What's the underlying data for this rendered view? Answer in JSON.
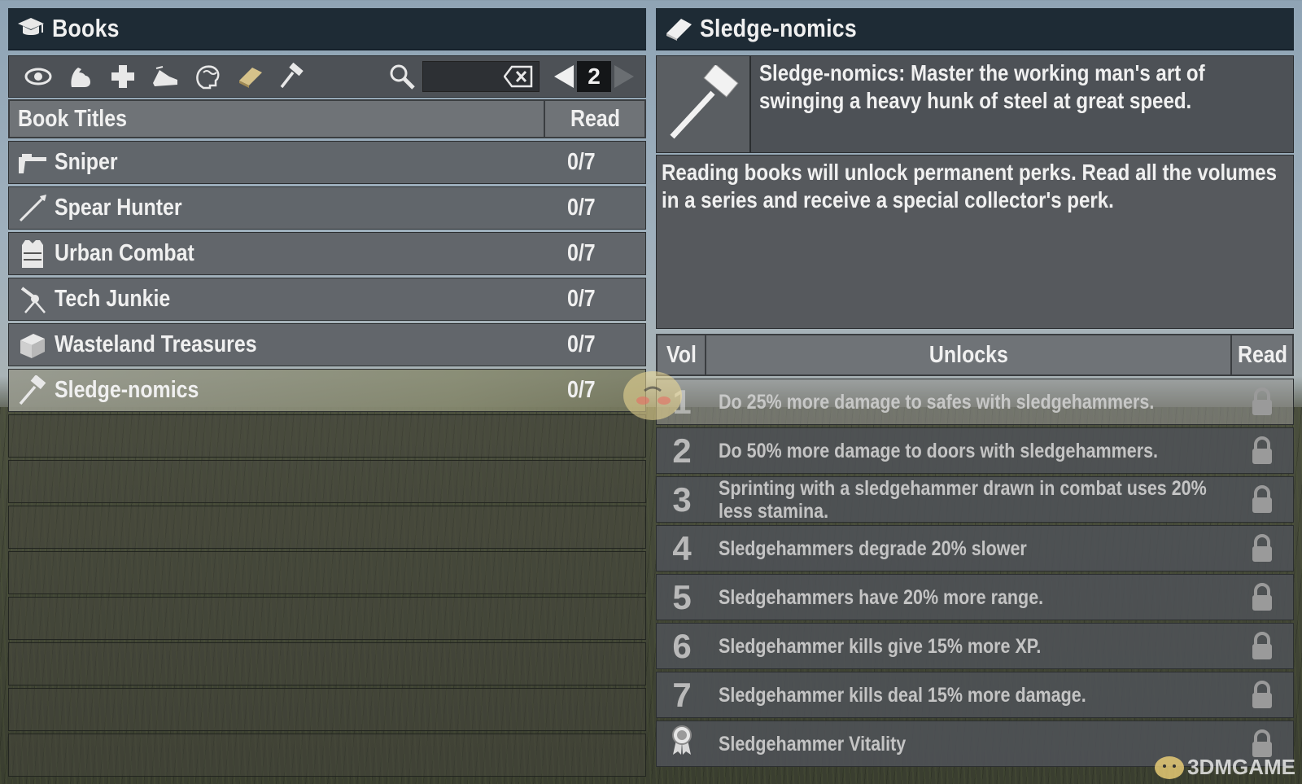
{
  "left": {
    "title": "Books",
    "title_icon": "graduation-cap-icon",
    "filters": [
      "eye-icon",
      "strength-arm-icon",
      "medical-cross-icon",
      "running-shoe-icon",
      "brain-icon",
      "book-icon",
      "hammer-icon"
    ],
    "search": {
      "value": "",
      "placeholder": ""
    },
    "page": "2",
    "columns": {
      "title": "Book Titles",
      "read": "Read"
    },
    "books": [
      {
        "name": "Sniper",
        "count": "0/7",
        "icon": "rifle-icon"
      },
      {
        "name": "Spear Hunter",
        "count": "0/7",
        "icon": "spear-icon"
      },
      {
        "name": "Urban Combat",
        "count": "0/7",
        "icon": "armor-vest-icon"
      },
      {
        "name": "Tech Junkie",
        "count": "0/7",
        "icon": "turret-icon"
      },
      {
        "name": "Wasteland Treasures",
        "count": "0/7",
        "icon": "treasure-chest-icon"
      },
      {
        "name": "Sledge-nomics",
        "count": "0/7",
        "icon": "sledgehammer-icon",
        "selected": true
      }
    ],
    "empty_rows": 8
  },
  "right": {
    "title": "Sledge-nomics",
    "title_icon": "book-icon",
    "summary": "Sledge-nomics: Master the working man's art of swinging a heavy hunk of steel at great speed.",
    "description": "Reading books will unlock permanent perks. Read all the volumes in a series and receive a special collector's perk.",
    "columns": {
      "vol": "Vol",
      "unlocks": "Unlocks",
      "read": "Read"
    },
    "perks": [
      {
        "vol": "1",
        "text": "Do 25% more damage to safes with sledgehammers."
      },
      {
        "vol": "2",
        "text": "Do 50% more damage to doors with sledgehammers."
      },
      {
        "vol": "3",
        "text": "Sprinting with a sledgehammer drawn in combat uses 20% less stamina."
      },
      {
        "vol": "4",
        "text": "Sledgehammers degrade 20% slower"
      },
      {
        "vol": "5",
        "text": "Sledgehammers have 20% more range."
      },
      {
        "vol": "6",
        "text": "Sledgehammer kills give 15% more XP."
      },
      {
        "vol": "7",
        "text": "Sledgehammer kills deal 15% more damage."
      }
    ],
    "collector_perk": {
      "text": "Sledgehammer Vitality",
      "icon": "award-ribbon-icon"
    }
  },
  "watermark": "3DMGAME",
  "colors": {
    "header": "#1e2b35",
    "toolbar": "#4d5156",
    "column_header": "#6f7377",
    "row": "#5c6064"
  }
}
